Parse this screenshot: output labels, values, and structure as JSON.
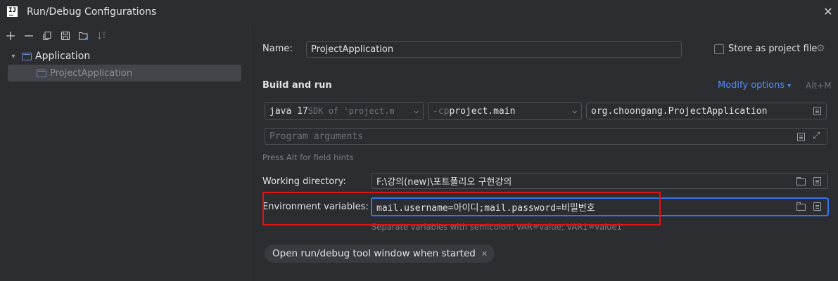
{
  "window": {
    "title": "Run/Debug Configurations",
    "logo_text": "IJ"
  },
  "tree": {
    "group_label": "Application",
    "item_label": "ProjectApplication"
  },
  "form": {
    "name_label": "Name:",
    "name_value": "ProjectApplication",
    "store_label": "Store as project file",
    "section_title": "Build and run",
    "modify_options": "Modify options",
    "modify_shortcut": "Alt+M",
    "jdk": {
      "main": "java 17",
      "detail": " SDK of 'project.m"
    },
    "classpath": {
      "prefix": "-cp ",
      "value": "project.main"
    },
    "main_class": "org.choongang.ProjectApplication",
    "program_args_placeholder": "Program arguments",
    "alt_hint": "Press Alt for field hints",
    "working_dir_label": "Working directory:",
    "working_dir_value": "F:\\강의(new)\\포트폴리오 구현강의",
    "env_label": "Environment variables:",
    "env_value": "mail.username=아이디;mail.password=비밀번호",
    "env_hint": "Separate variables with semicolon: VAR=value; VAR1=value1",
    "tag_label": "Open run/debug tool window when started"
  },
  "colors": {
    "accent": "#548af7",
    "highlight": "#e31212",
    "focus": "#3574f0"
  }
}
